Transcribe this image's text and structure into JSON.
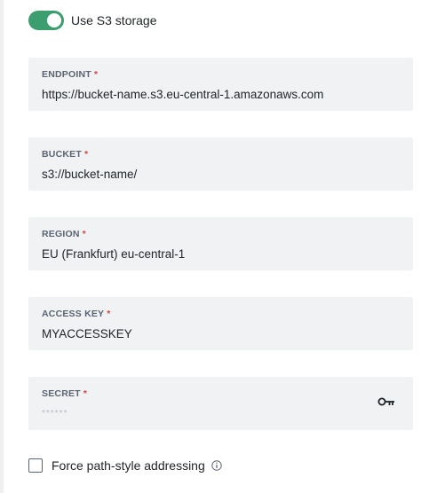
{
  "toggle": {
    "label": "Use S3 storage",
    "on": true,
    "color": "#3c9d6f"
  },
  "fields": {
    "endpoint": {
      "label": "ENDPOINT",
      "required_mark": "*",
      "value": "https://bucket-name.s3.eu-central-1.amazonaws.com"
    },
    "bucket": {
      "label": "BUCKET",
      "required_mark": "*",
      "value": "s3://bucket-name/"
    },
    "region": {
      "label": "REGION",
      "required_mark": "*",
      "value": "EU (Frankfurt) eu-central-1"
    },
    "access_key": {
      "label": "ACCESS KEY",
      "required_mark": "*",
      "value": "MYACCESSKEY"
    },
    "secret": {
      "label": "SECRET",
      "required_mark": "*",
      "masked_value": "******",
      "icon": "key-icon"
    }
  },
  "checkbox": {
    "label": "Force path-style addressing",
    "checked": false,
    "icon": "info-icon"
  }
}
